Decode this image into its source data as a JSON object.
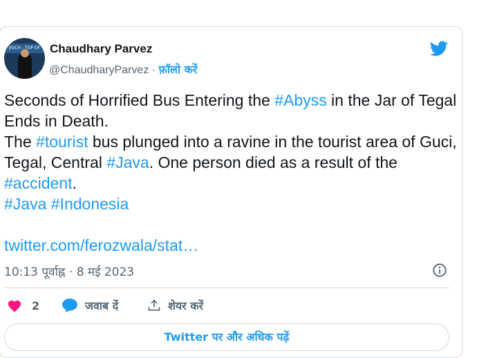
{
  "author": {
    "name": "Chaudhary Parvez",
    "handle": "@ChaudharyParvez",
    "separator": " · ",
    "follow_label": "फ़ॉलो करें",
    "avatar_banner_text": "JIOCH - TOP OF"
  },
  "tweet": {
    "line1_pre": "Seconds of Horrified Bus Entering the ",
    "hashtag_abyss": "#Abyss",
    "line1_post": " in the Jar of Tegal Ends in Death.",
    "line2_pre": "The ",
    "hashtag_tourist": "#tourist",
    "line2_mid": " bus plunged into a ravine in the tourist area of Guci, Tegal, Central ",
    "hashtag_java1": "#Java",
    "line2_post": ". One person died as a result of the ",
    "hashtag_accident": "#accident",
    "line2_end": ".",
    "hashtag_java2": "#Java",
    "hashtag_indonesia": "#Indonesia",
    "link_text": "twitter.com/ferozwala/stat…"
  },
  "meta": {
    "timestamp": "10:13 पूर्वाह्न · 8 मई 2023"
  },
  "actions": {
    "like_count": "2",
    "reply_label": "जवाब दें",
    "share_label": "शेयर करें"
  },
  "more_button_label": "Twitter पर और अधिक पढ़ें",
  "colors": {
    "accent": "#1d9bf0",
    "like": "#f91880",
    "muted": "#536471",
    "border": "#cfd9de"
  }
}
